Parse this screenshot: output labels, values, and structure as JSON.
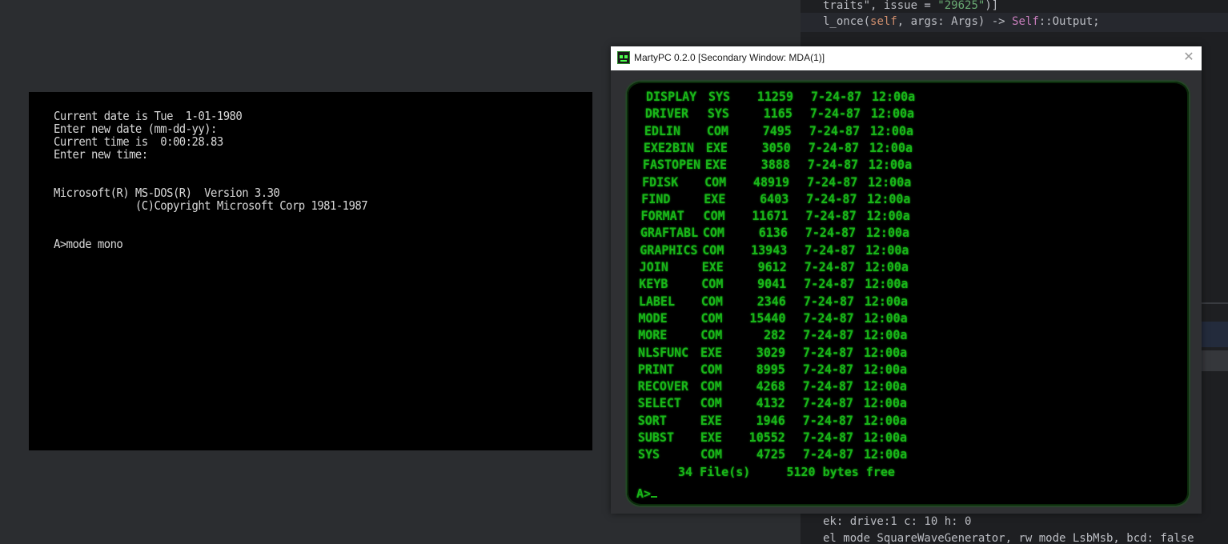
{
  "ide": {
    "code_line_1_a": "traits\", issue = ",
    "code_line_1_b": "\"29625\"",
    "code_line_1_c": ")]",
    "code_line_2_a": "l_once(",
    "code_line_2_b": "self",
    "code_line_2_c": ", args: Args) -> ",
    "code_line_2_d": "Self",
    "code_line_2_e": "::Output;",
    "log_line_1": "ek: drive:1 c: 10 h: 0",
    "log_line_2": "el mode SquareWaveGenerator, rw mode LsbMsb, bcd: false"
  },
  "cga": {
    "lines": [
      "Current date is Tue  1-01-1980",
      "Enter new date (mm-dd-yy):",
      "Current time is  0:00:28.83",
      "Enter new time:",
      "",
      "",
      "Microsoft(R) MS-DOS(R)  Version 3.30",
      "             (C)Copyright Microsoft Corp 1981-1987",
      "",
      "",
      "A>mode mono"
    ]
  },
  "window": {
    "title": "MartyPC 0.2.0 [Secondary Window: MDA(1)]",
    "close_glyph": "✕"
  },
  "mda": {
    "files": [
      {
        "name": "DISPLAY",
        "ext": "SYS",
        "size": "11259",
        "date": "7-24-87",
        "time": "12:00a"
      },
      {
        "name": "DRIVER",
        "ext": "SYS",
        "size": "1165",
        "date": "7-24-87",
        "time": "12:00a"
      },
      {
        "name": "EDLIN",
        "ext": "COM",
        "size": "7495",
        "date": "7-24-87",
        "time": "12:00a"
      },
      {
        "name": "EXE2BIN",
        "ext": "EXE",
        "size": "3050",
        "date": "7-24-87",
        "time": "12:00a"
      },
      {
        "name": "FASTOPEN",
        "ext": "EXE",
        "size": "3888",
        "date": "7-24-87",
        "time": "12:00a"
      },
      {
        "name": "FDISK",
        "ext": "COM",
        "size": "48919",
        "date": "7-24-87",
        "time": "12:00a"
      },
      {
        "name": "FIND",
        "ext": "EXE",
        "size": "6403",
        "date": "7-24-87",
        "time": "12:00a"
      },
      {
        "name": "FORMAT",
        "ext": "COM",
        "size": "11671",
        "date": "7-24-87",
        "time": "12:00a"
      },
      {
        "name": "GRAFTABL",
        "ext": "COM",
        "size": "6136",
        "date": "7-24-87",
        "time": "12:00a"
      },
      {
        "name": "GRAPHICS",
        "ext": "COM",
        "size": "13943",
        "date": "7-24-87",
        "time": "12:00a"
      },
      {
        "name": "JOIN",
        "ext": "EXE",
        "size": "9612",
        "date": "7-24-87",
        "time": "12:00a"
      },
      {
        "name": "KEYB",
        "ext": "COM",
        "size": "9041",
        "date": "7-24-87",
        "time": "12:00a"
      },
      {
        "name": "LABEL",
        "ext": "COM",
        "size": "2346",
        "date": "7-24-87",
        "time": "12:00a"
      },
      {
        "name": "MODE",
        "ext": "COM",
        "size": "15440",
        "date": "7-24-87",
        "time": "12:00a"
      },
      {
        "name": "MORE",
        "ext": "COM",
        "size": "282",
        "date": "7-24-87",
        "time": "12:00a"
      },
      {
        "name": "NLSFUNC",
        "ext": "EXE",
        "size": "3029",
        "date": "7-24-87",
        "time": "12:00a"
      },
      {
        "name": "PRINT",
        "ext": "COM",
        "size": "8995",
        "date": "7-24-87",
        "time": "12:00a"
      },
      {
        "name": "RECOVER",
        "ext": "COM",
        "size": "4268",
        "date": "7-24-87",
        "time": "12:00a"
      },
      {
        "name": "SELECT",
        "ext": "COM",
        "size": "4132",
        "date": "7-24-87",
        "time": "12:00a"
      },
      {
        "name": "SORT",
        "ext": "EXE",
        "size": "1946",
        "date": "7-24-87",
        "time": "12:00a"
      },
      {
        "name": "SUBST",
        "ext": "EXE",
        "size": "10552",
        "date": "7-24-87",
        "time": "12:00a"
      },
      {
        "name": "SYS",
        "ext": "COM",
        "size": "4725",
        "date": "7-24-87",
        "time": "12:00a"
      }
    ],
    "summary": "34 File(s)     5120 bytes free",
    "prompt": "A>"
  },
  "colors": {
    "mda_green": "#19b519",
    "cga_text": "#d7d7d7",
    "desktop_bg": "#2b2d30"
  }
}
